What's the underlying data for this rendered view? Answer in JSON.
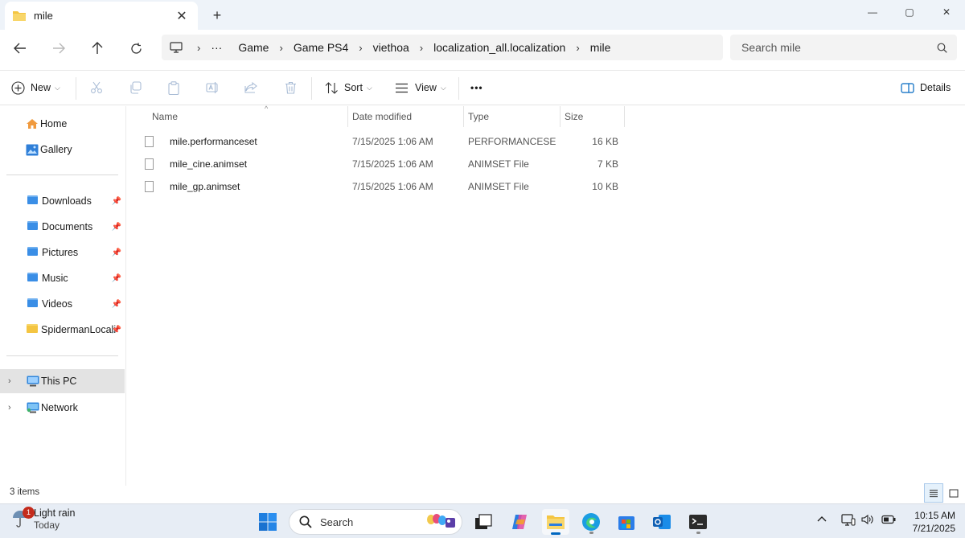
{
  "window": {
    "tab_title": "mile",
    "new_tab_label": "+",
    "minimize": "—",
    "maximize": "▢",
    "close": "✕"
  },
  "address": {
    "overflow": "···",
    "crumbs": [
      "Game",
      "Game PS4",
      "viethoa",
      "localization_all.localization",
      "mile"
    ],
    "separator": "›",
    "search_placeholder": "Search mile"
  },
  "commands": {
    "new_label": "New",
    "sort_label": "Sort",
    "view_label": "View",
    "more_label": "•••",
    "details_label": "Details"
  },
  "nav": {
    "quick": [
      {
        "label": "Home",
        "icon": "home-icon"
      },
      {
        "label": "Gallery",
        "icon": "gallery-icon"
      }
    ],
    "pinned": [
      {
        "label": "Downloads",
        "icon": "downloads-folder-icon"
      },
      {
        "label": "Documents",
        "icon": "documents-folder-icon"
      },
      {
        "label": "Pictures",
        "icon": "pictures-folder-icon"
      },
      {
        "label": "Music",
        "icon": "music-folder-icon"
      },
      {
        "label": "Videos",
        "icon": "videos-folder-icon"
      },
      {
        "label": "SpidermanLocali...",
        "icon": "folder-icon"
      }
    ],
    "devices": [
      {
        "label": "This PC",
        "icon": "this-pc-icon",
        "selected": true
      },
      {
        "label": "Network",
        "icon": "network-icon",
        "selected": false
      }
    ]
  },
  "columns": [
    "Name",
    "Date modified",
    "Type",
    "Size"
  ],
  "files": [
    {
      "name": "mile.performanceset",
      "date": "7/15/2025 1:06 AM",
      "type": "PERFORMANCESE...",
      "size": "16 KB"
    },
    {
      "name": "mile_cine.animset",
      "date": "7/15/2025 1:06 AM",
      "type": "ANIMSET File",
      "size": "7 KB"
    },
    {
      "name": "mile_gp.animset",
      "date": "7/15/2025 1:06 AM",
      "type": "ANIMSET File",
      "size": "10 KB"
    }
  ],
  "status": {
    "item_count": "3 items"
  },
  "taskbar": {
    "weather_line1": "Light rain",
    "weather_line2": "Today",
    "weather_badge": "1",
    "search_label": "Search",
    "time": "10:15 AM",
    "date": "7/21/2025"
  },
  "colors": {
    "accent": "#0067c0",
    "folder_blue": "#3a8ee6",
    "folder_yellow": "#f4c542",
    "selection": "#e3e3e3"
  }
}
